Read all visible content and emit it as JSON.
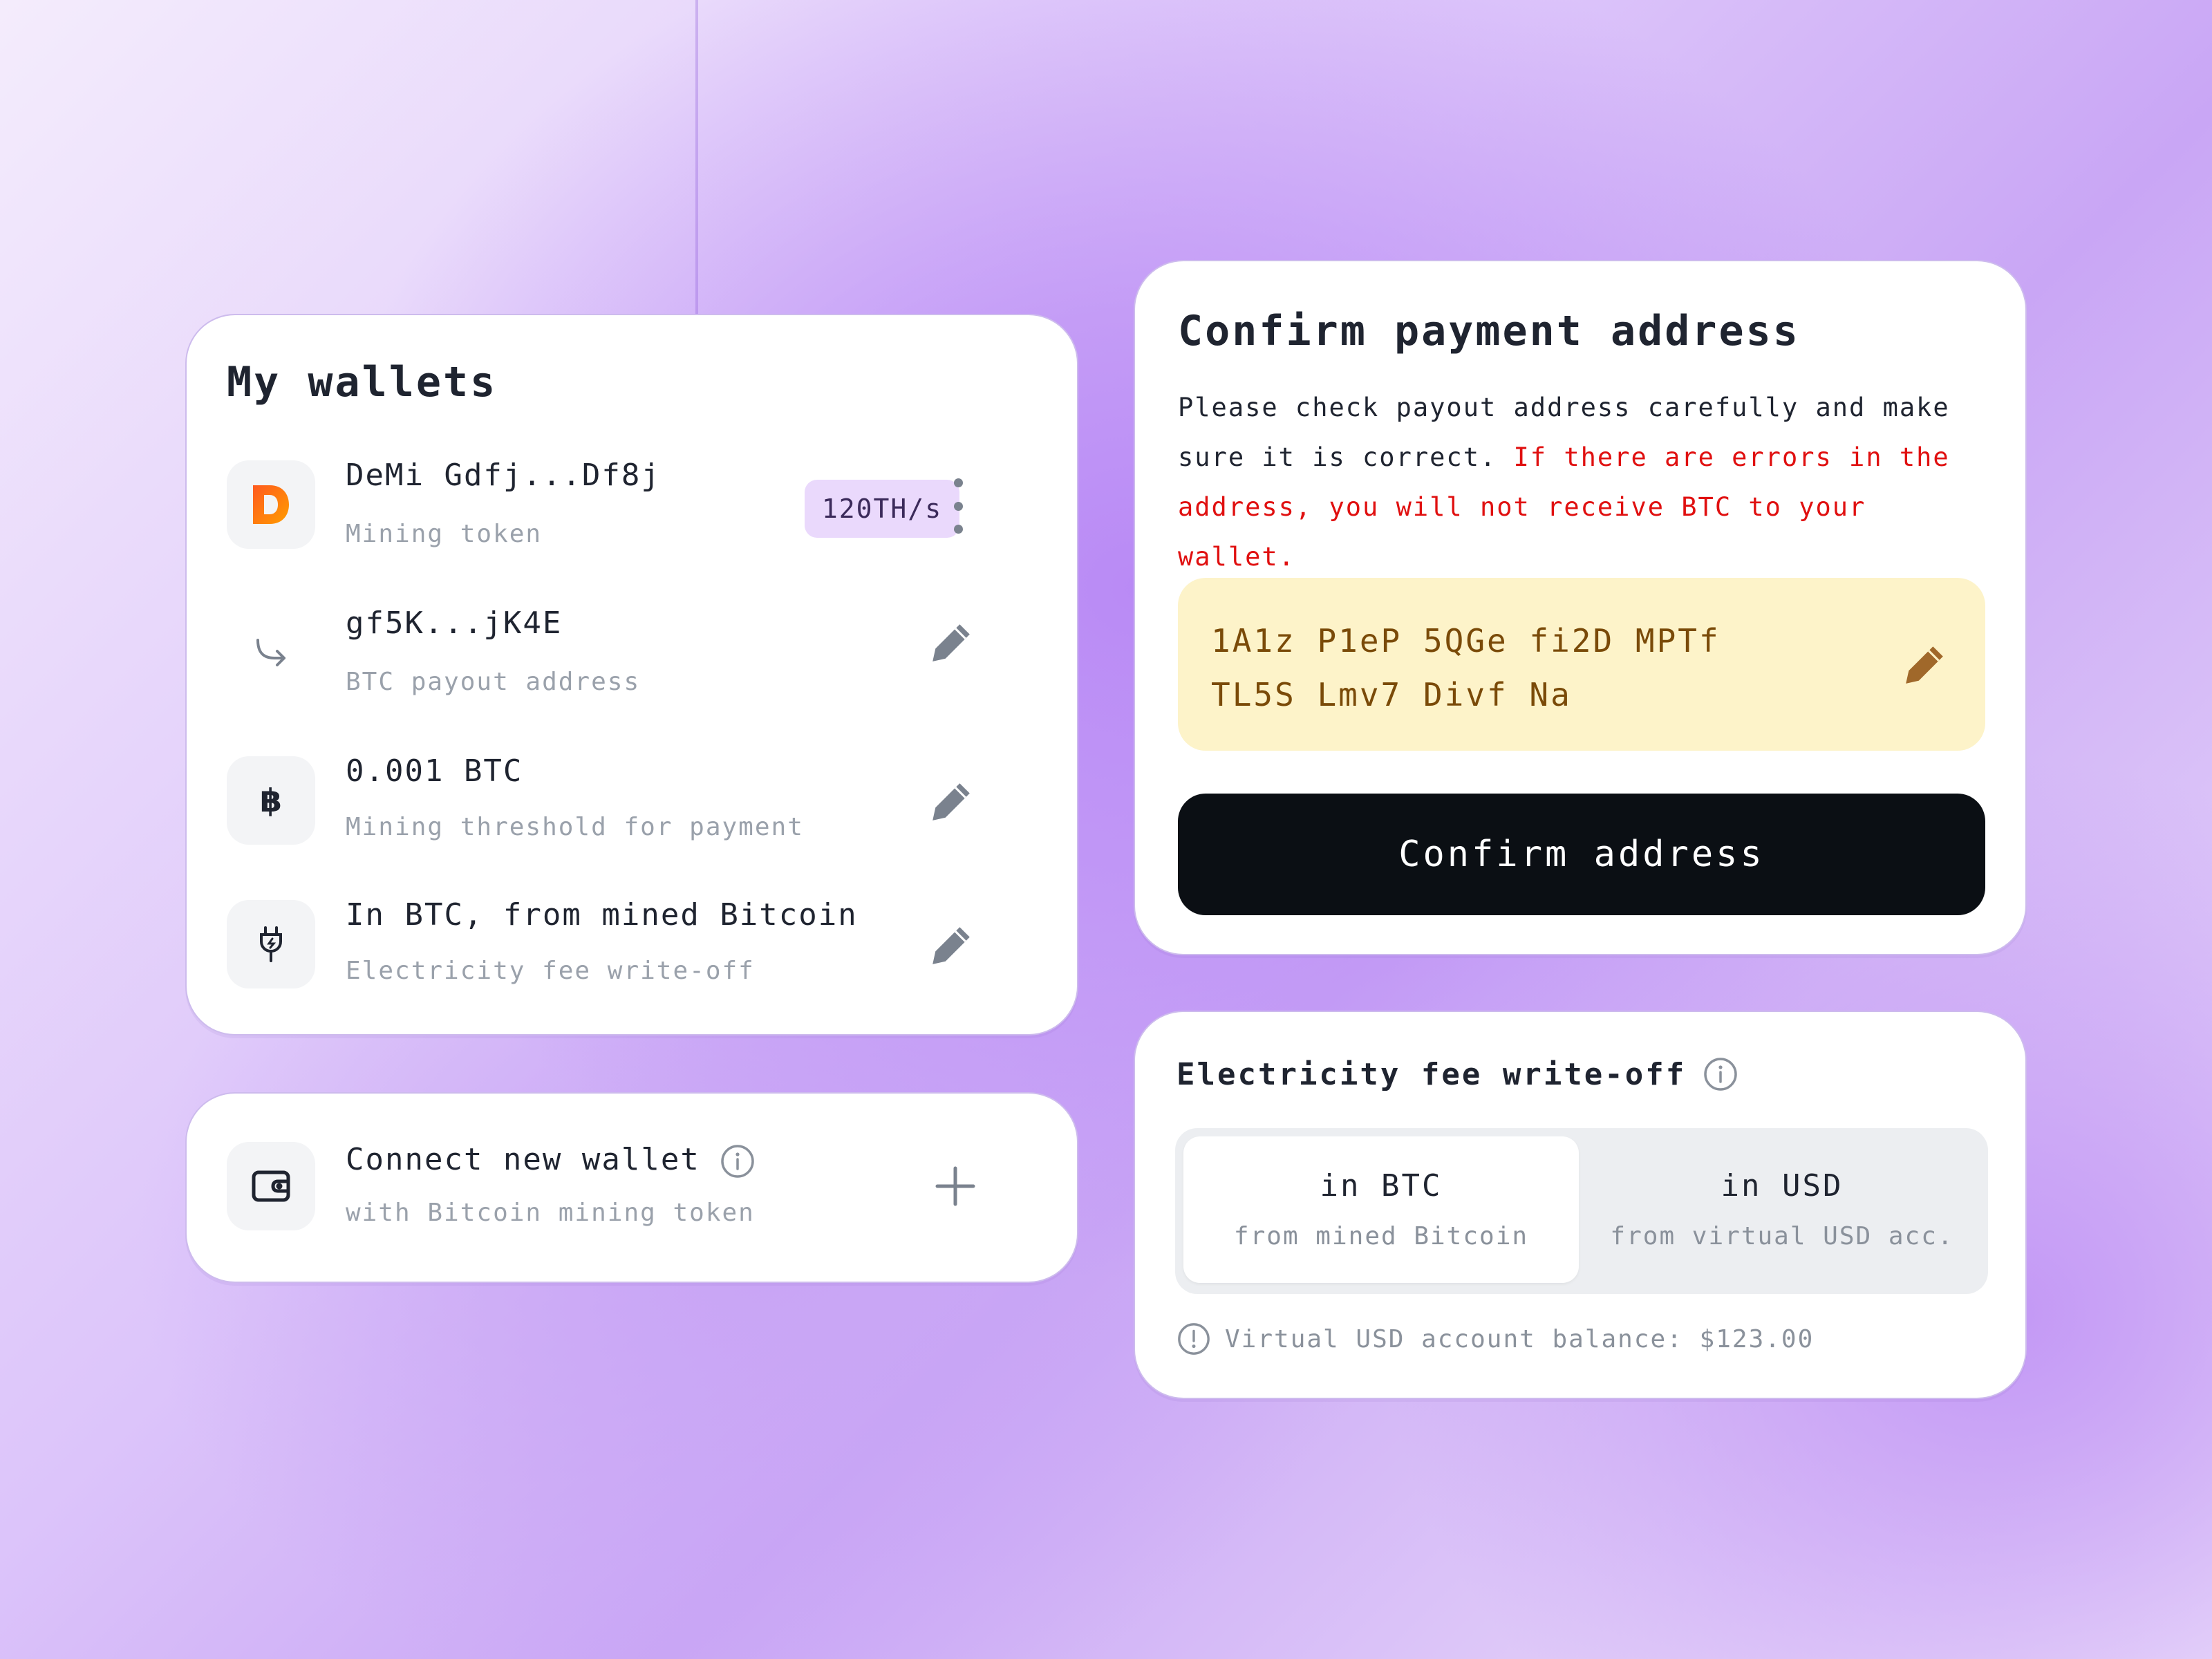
{
  "wallets": {
    "title": "My wallets",
    "items": [
      {
        "title": "DeMi Gdfj...Df8j",
        "subtitle": "Mining token",
        "badge": "120TH/s",
        "icon": "demi-logo-icon"
      },
      {
        "title": "gf5K...jK4E",
        "subtitle": "BTC payout address",
        "icon": "arrow-return-icon"
      },
      {
        "title": "0.001 BTC",
        "subtitle": "Mining threshold for payment",
        "icon": "bitcoin-icon"
      },
      {
        "title": "In BTC, from mined Bitcoin",
        "subtitle": "Electricity fee write-off",
        "icon": "plug-icon"
      }
    ]
  },
  "connect": {
    "title": "Connect new wallet",
    "subtitle": "with Bitcoin mining token"
  },
  "confirm": {
    "title": "Confirm payment address",
    "text_normal": "Please check payout address carefully and make sure it is correct. ",
    "text_warning": "If there are errors in the address, you will not receive BTC to your wallet.",
    "address_line1": "1A1z P1eP 5QGe fi2D MPTf",
    "address_line2": "TL5S Lmv7 Divf Na",
    "button_label": "Confirm address"
  },
  "electricity": {
    "title": "Electricity fee write-off",
    "options": [
      {
        "title": "in BTC",
        "subtitle": "from mined Bitcoin",
        "selected": true
      },
      {
        "title": "in USD",
        "subtitle": "from virtual USD acc.",
        "selected": false
      }
    ],
    "balance": "Virtual USD account balance: $123.00"
  },
  "colors": {
    "accent_bg": "#b98af5",
    "warning_text": "#e01010",
    "address_bg": "#fdf3c9",
    "address_text": "#7a4a08",
    "button_bg": "#0b0f14",
    "badge_bg": "#ead9fc"
  }
}
